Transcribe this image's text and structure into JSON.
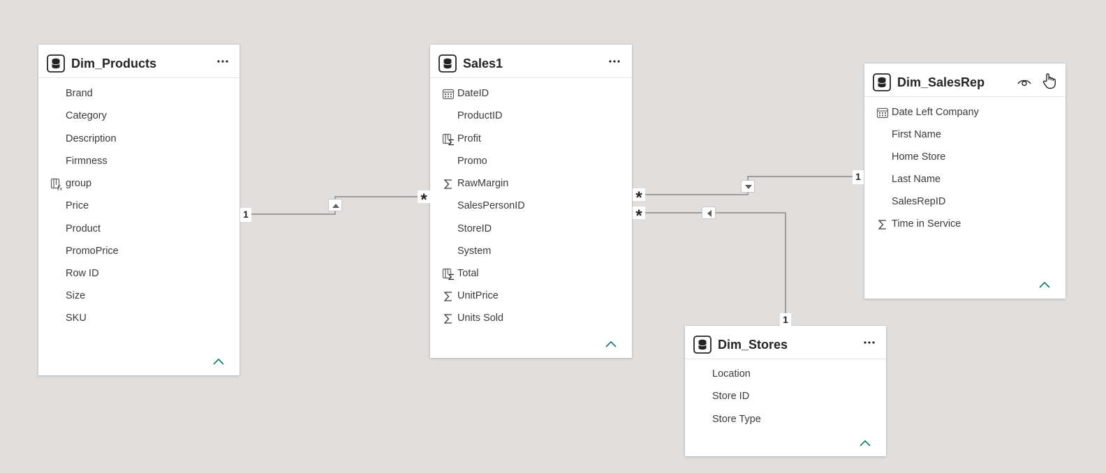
{
  "tables": {
    "products": {
      "title": "Dim_Products",
      "icon": "table-icon",
      "fields": [
        {
          "label": "Brand",
          "icon": ""
        },
        {
          "label": "Category",
          "icon": ""
        },
        {
          "label": "Description",
          "icon": ""
        },
        {
          "label": "Firmness",
          "icon": ""
        },
        {
          "label": "group",
          "icon": "calculated-column-icon"
        },
        {
          "label": "Price",
          "icon": ""
        },
        {
          "label": "Product",
          "icon": ""
        },
        {
          "label": "PromoPrice",
          "icon": ""
        },
        {
          "label": "Row ID",
          "icon": ""
        },
        {
          "label": "Size",
          "icon": ""
        },
        {
          "label": "SKU",
          "icon": ""
        }
      ]
    },
    "sales": {
      "title": "Sales1",
      "icon": "table-icon",
      "fields": [
        {
          "label": "DateID",
          "icon": "calendar-icon"
        },
        {
          "label": "ProductID",
          "icon": ""
        },
        {
          "label": "Profit",
          "icon": "measure-icon"
        },
        {
          "label": "Promo",
          "icon": ""
        },
        {
          "label": "RawMargin",
          "icon": "sigma-icon"
        },
        {
          "label": "SalesPersonID",
          "icon": ""
        },
        {
          "label": "StoreID",
          "icon": ""
        },
        {
          "label": "System",
          "icon": ""
        },
        {
          "label": "Total",
          "icon": "measure-icon"
        },
        {
          "label": "UnitPrice",
          "icon": "sigma-icon"
        },
        {
          "label": "Units Sold",
          "icon": "sigma-icon"
        }
      ]
    },
    "salesrep": {
      "title": "Dim_SalesRep",
      "icon": "table-icon",
      "fields": [
        {
          "label": "Date Left Company",
          "icon": "calendar-icon"
        },
        {
          "label": "First Name",
          "icon": ""
        },
        {
          "label": "Home Store",
          "icon": ""
        },
        {
          "label": "Last Name",
          "icon": ""
        },
        {
          "label": "SalesRepID",
          "icon": ""
        },
        {
          "label": "Time in Service",
          "icon": "sigma-icon"
        }
      ]
    },
    "stores": {
      "title": "Dim_Stores",
      "icon": "table-icon",
      "fields": [
        {
          "label": "Location",
          "icon": ""
        },
        {
          "label": "Store ID",
          "icon": ""
        },
        {
          "label": "Store Type",
          "icon": ""
        }
      ]
    }
  },
  "relationships": {
    "products_sales": {
      "from": "Dim_Products",
      "to": "Sales1",
      "from_card": "1",
      "to_card": "*",
      "filter_direction": "up-arrow-icon"
    },
    "salesrep_sales": {
      "from": "Dim_SalesRep",
      "to": "Sales1",
      "from_card": "1",
      "to_card": "*",
      "filter_direction": "down-arrow-icon"
    },
    "stores_sales": {
      "from": "Dim_Stores",
      "to": "Sales1",
      "from_card": "1",
      "to_card": "*",
      "filter_direction": "left-arrow-icon"
    }
  },
  "icons": {
    "more": "ellipsis-icon",
    "collapse": "chevron-up-icon",
    "visibility": "eye-icon",
    "cursor": "hand-pointer-icon"
  },
  "colors": {
    "canvas": "#e1dfdd",
    "card": "#ffffff",
    "line": "#8a8886",
    "accent": "#117865",
    "text": "#252423"
  }
}
